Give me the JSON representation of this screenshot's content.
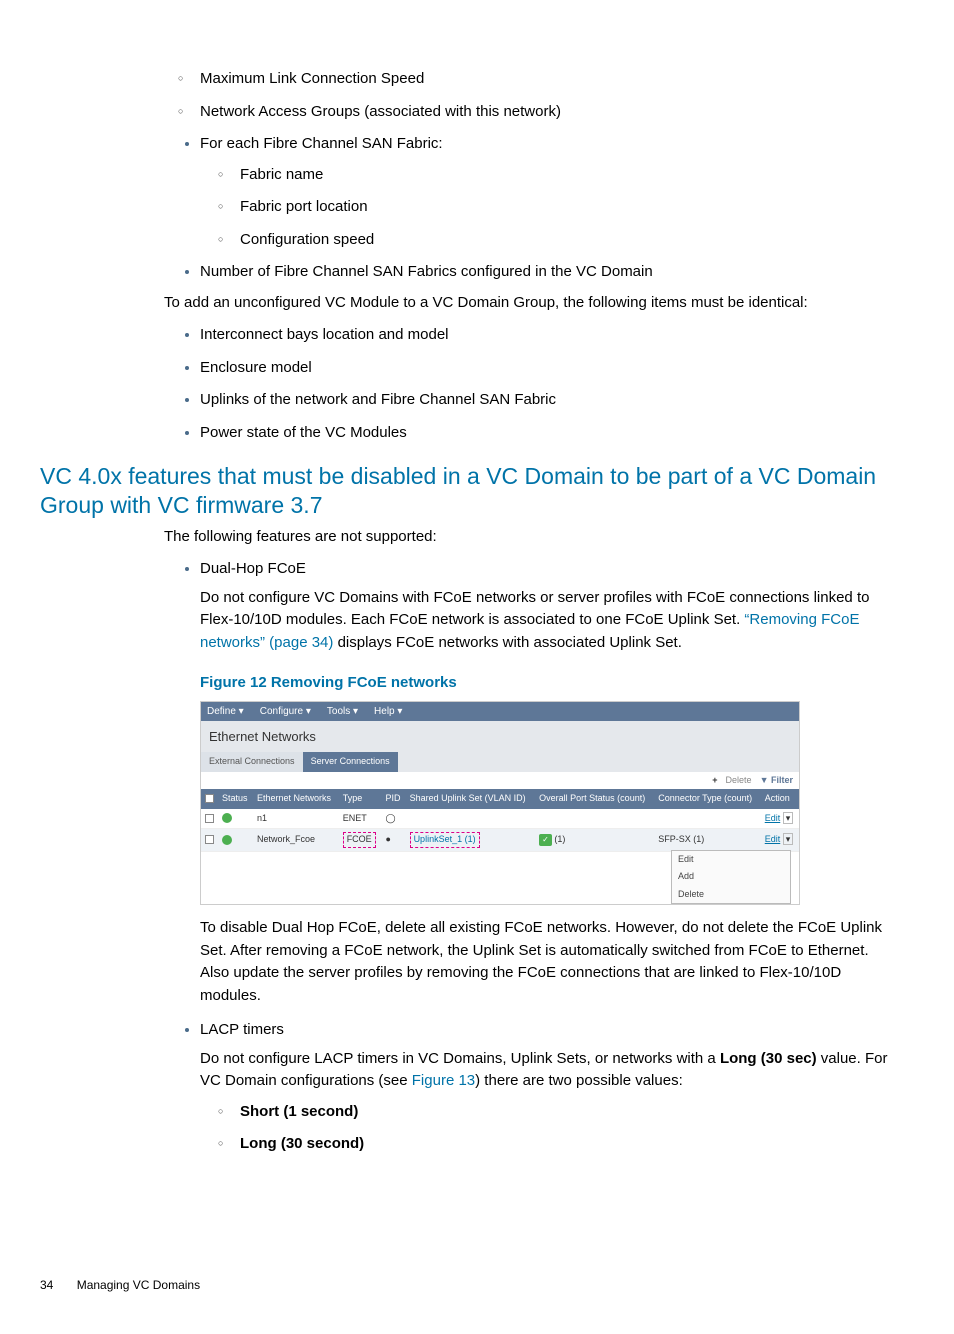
{
  "top_list2": [
    "Maximum Link Connection Speed",
    "Network Access Groups (associated with this network)"
  ],
  "fc_item": "For each Fibre Channel SAN Fabric:",
  "fc_sub": [
    "Fabric name",
    "Fabric port location",
    "Configuration speed"
  ],
  "num_fc": "Number of Fibre Channel SAN Fabrics configured in the VC Domain",
  "add_para": "To add an unconfigured VC Module to a VC Domain Group, the following items must be identical:",
  "ident_list": [
    "Interconnect bays location and model",
    "Enclosure model",
    "Uplinks of the network and Fibre Channel SAN Fabric",
    "Power state of the VC Modules"
  ],
  "section_h": "VC 4.0x features that must be disabled in a VC Domain to be part of a VC Domain Group with VC firmware 3.7",
  "following": "The following features are not supported:",
  "dual_name": "Dual-Hop FCoE",
  "dual_p1a": "Do not configure VC Domains with FCoE networks or server profiles with FCoE connections linked to Flex-10/10D modules. Each FCoE network is associated to one FCoE Uplink Set. ",
  "dual_link": "“Removing FCoE networks” (page 34)",
  "dual_p1b": " displays FCoE networks with associated Uplink Set.",
  "fig_label": "Figure 12 Removing FCoE networks",
  "fig": {
    "menu": [
      "Define ▾",
      "Configure ▾",
      "Tools ▾",
      "Help ▾"
    ],
    "title": "Ethernet Networks",
    "tab_inactive": "External Connections",
    "tab_active": "Server Connections",
    "toolbar": {
      "plus": "+",
      "delete": "Delete",
      "filter": "Filter"
    },
    "head": [
      "",
      "Status",
      "Ethernet Networks",
      "Type",
      "PID",
      "Shared Uplink Set (VLAN ID)",
      "Overall Port Status (count)",
      "Connector Type (count)",
      "Action"
    ],
    "row1": {
      "net": "n1",
      "type": "ENET",
      "edit": "Edit"
    },
    "row2": {
      "net": "Network_Fcoe",
      "type": "FCOE",
      "sus": "UplinkSet_1 (1)",
      "ops": "(1)",
      "conn": "SFP-SX (1)",
      "edit": "Edit"
    },
    "drop": [
      "Edit",
      "Add",
      "Delete"
    ]
  },
  "dual_p2": "To disable Dual Hop FCoE, delete all existing FCoE networks. However, do not delete the FCoE Uplink Set. After removing a FCoE network, the Uplink Set is automatically switched from FCoE to Ethernet. Also update the server profiles by removing the FCoE connections that are linked to Flex-10/10D modules.",
  "lacp_name": "LACP timers",
  "lacp_p_a": "Do not configure LACP timers in VC Domains, Uplink Sets, or networks with a ",
  "lacp_bold": "Long (30 sec)",
  "lacp_p_b": " value. For VC Domain configurations (see ",
  "lacp_link": "Figure 13",
  "lacp_p_c": ") there are two possible values:",
  "lacp_sub": [
    "Short (1 second)",
    "Long (30 second)"
  ],
  "footer_page": "34",
  "footer_title": "Managing VC Domains"
}
